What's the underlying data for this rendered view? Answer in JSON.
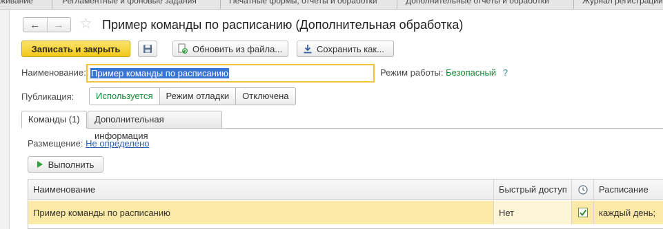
{
  "window_tabs": [
    "живание",
    "Регламентные и фоновые задания",
    "Печатные формы, отчеты и обработки",
    "Дополнительные отчеты и обработки",
    "Журнал регистрации"
  ],
  "title": "Пример команды по расписанию (Дополнительная обработка)",
  "toolbar": {
    "save_close": "Записать и закрыть",
    "reload": "Обновить из файла...",
    "save_as": "Сохранить как..."
  },
  "form": {
    "name_label": "Наименование:",
    "name_value": "Пример команды по расписанию",
    "mode_label": "Режим работы:",
    "mode_value": "Безопасный",
    "mode_help": "?",
    "publication_label": "Публикация:",
    "publication_options": [
      "Используется",
      "Режим отладки",
      "Отключена"
    ],
    "publication_selected": "Используется"
  },
  "tabs": [
    "Команды (1)",
    "Дополнительная информация"
  ],
  "commands": {
    "placement_label": "Размещение:",
    "placement_value": "Не определено",
    "run_button": "Выполнить",
    "columns": [
      "Наименование",
      "Быстрый доступ",
      "",
      "Расписание"
    ],
    "rows": [
      {
        "name": "Пример команды по расписанию",
        "quick_access": "Нет",
        "scheduled": true,
        "schedule": "каждый день;"
      }
    ]
  }
}
